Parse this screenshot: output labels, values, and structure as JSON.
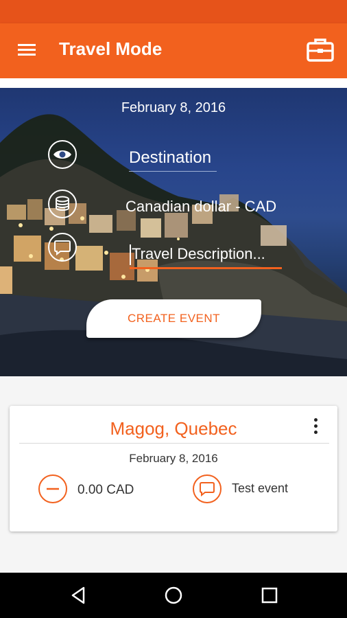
{
  "app": {
    "title": "Travel Mode",
    "accent_color": "#f2611e",
    "status_bar_color": "#e6531a"
  },
  "icons": {
    "menu": "hamburger-menu-icon",
    "briefcase": "briefcase-icon",
    "destination": "eye-icon",
    "currency": "coins-icon",
    "description": "comment-icon",
    "expense": "minus-circle-icon",
    "event_note": "comment-icon"
  },
  "hero": {
    "date": "February 8, 2016",
    "destination_label": "Destination",
    "currency_label": "Canadian dollar - CAD",
    "description_placeholder": "Travel Description...",
    "create_button_label": "CREATE EVENT"
  },
  "event_card": {
    "title": "Magog, Quebec",
    "date": "February 8, 2016",
    "amount": "0.00 CAD",
    "description": "Test event"
  },
  "navigation": {
    "back": "back-triangle-icon",
    "home": "home-circle-icon",
    "recents": "recents-square-icon"
  }
}
